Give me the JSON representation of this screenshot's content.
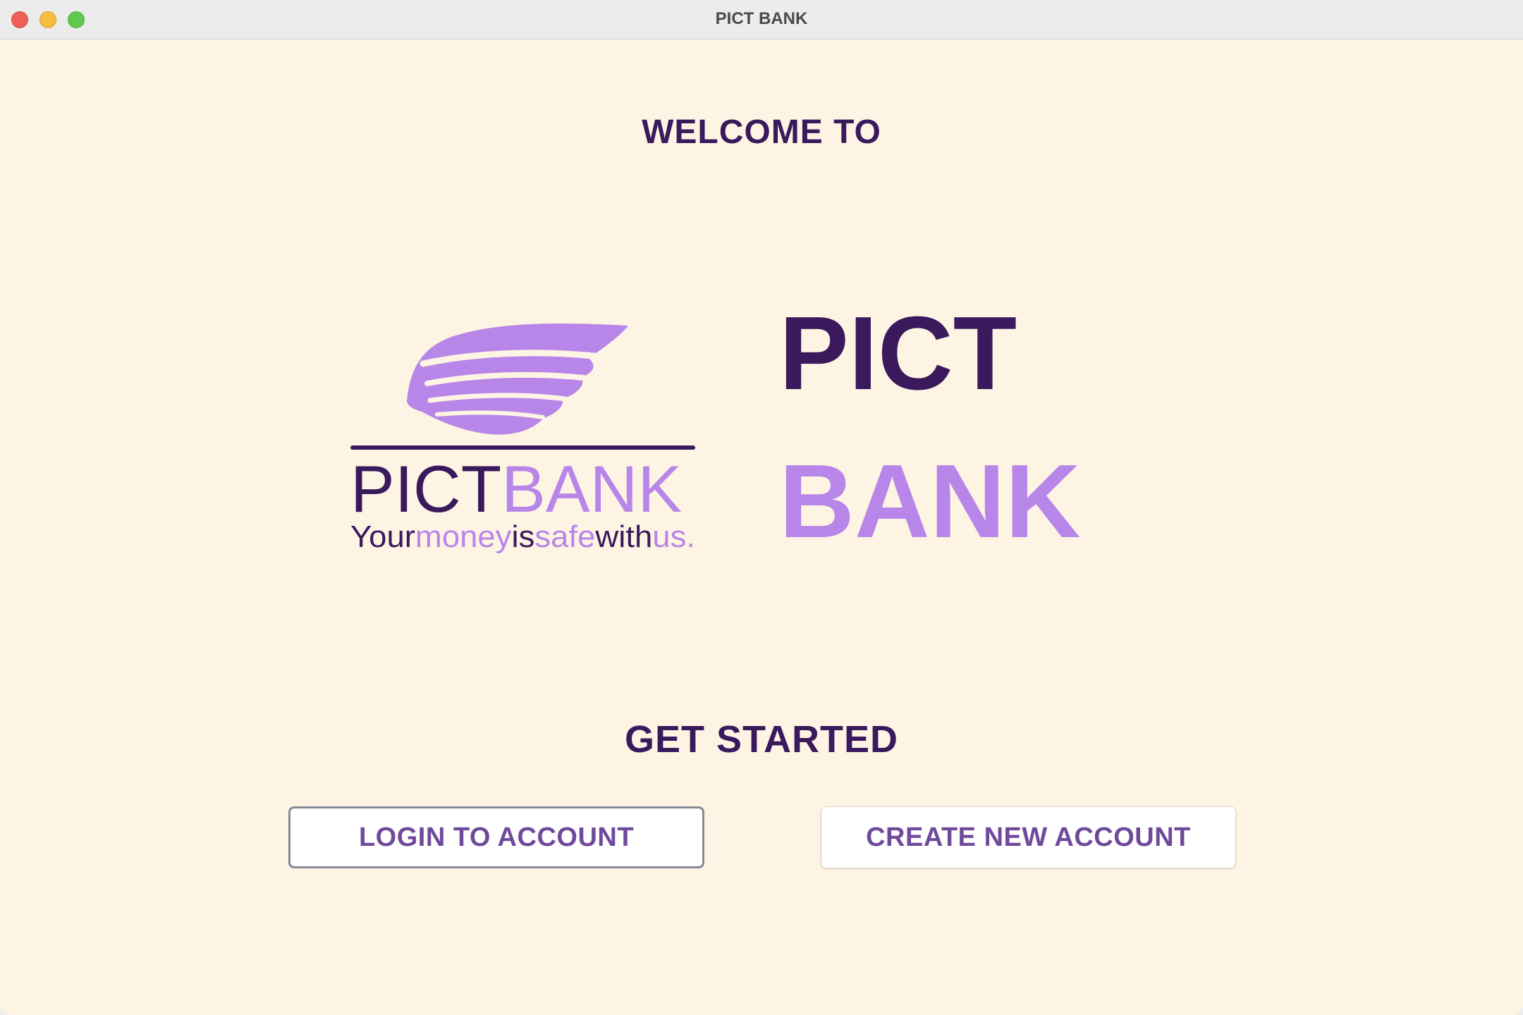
{
  "window": {
    "title": "PICT BANK"
  },
  "main": {
    "welcome_text": "WELCOME TO",
    "logo": {
      "word1": "PICT",
      "word2": "BANK",
      "tagline_words": [
        "Your",
        "money",
        "is",
        "safe",
        "with",
        "us."
      ]
    },
    "brand_line1": "PICT",
    "brand_line2": "BANK",
    "get_started_text": "GET STARTED",
    "login_button": "LOGIN TO ACCOUNT",
    "create_button": "CREATE NEW ACCOUNT"
  },
  "colors": {
    "background": "#fef4e4",
    "dark_purple": "#3a1a5c",
    "light_purple": "#b886e8",
    "button_text": "#6f4a9a"
  },
  "icons": {
    "logo_mark": "wing-icon"
  }
}
